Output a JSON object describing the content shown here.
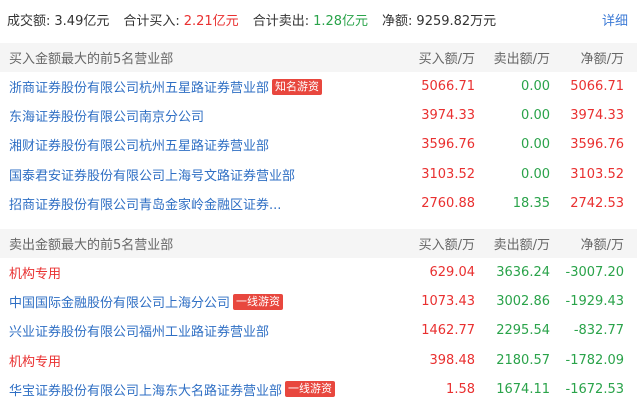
{
  "summary": {
    "turnover_label": "成交额:",
    "turnover_value": "3.49亿元",
    "total_buy_label": "合计买入:",
    "total_buy_value": "2.21亿元",
    "total_sell_label": "合计卖出:",
    "total_sell_value": "1.28亿元",
    "net_label": "净额:",
    "net_value": "9259.82万元",
    "detail_link": "详细"
  },
  "buy_section": {
    "title": "买入金额最大的前5名营业部",
    "col_buy": "买入额/万",
    "col_sell": "卖出额/万",
    "col_net": "净额/万",
    "rows": [
      {
        "name": "浙商证券股份有限公司杭州五星路证券营业部",
        "tag": "知名游资",
        "buy": "5066.71",
        "sell": "0.00",
        "net": "5066.71"
      },
      {
        "name": "东海证券股份有限公司南京分公司",
        "tag": "",
        "buy": "3974.33",
        "sell": "0.00",
        "net": "3974.33"
      },
      {
        "name": "湘财证券股份有限公司杭州五星路证券营业部",
        "tag": "",
        "buy": "3596.76",
        "sell": "0.00",
        "net": "3596.76"
      },
      {
        "name": "国泰君安证券股份有限公司上海号文路证券营业部",
        "tag": "",
        "buy": "3103.52",
        "sell": "0.00",
        "net": "3103.52"
      },
      {
        "name": "招商证券股份有限公司青岛金家岭金融区证券...",
        "tag": "",
        "buy": "2760.88",
        "sell": "18.35",
        "net": "2742.53"
      }
    ]
  },
  "sell_section": {
    "title": "卖出金额最大的前5名营业部",
    "col_buy": "买入额/万",
    "col_sell": "卖出额/万",
    "col_net": "净额/万",
    "rows": [
      {
        "name": "机构专用",
        "tag": "",
        "buy": "629.04",
        "sell": "3636.24",
        "net": "-3007.20"
      },
      {
        "name": "中国国际金融股份有限公司上海分公司",
        "tag": "一线游资",
        "buy": "1073.43",
        "sell": "3002.86",
        "net": "-1929.43"
      },
      {
        "name": "兴业证券股份有限公司福州工业路证券营业部",
        "tag": "",
        "buy": "1462.77",
        "sell": "2295.54",
        "net": "-832.77"
      },
      {
        "name": "机构专用",
        "tag": "",
        "buy": "398.48",
        "sell": "2180.57",
        "net": "-1782.09"
      },
      {
        "name": "华宝证券股份有限公司上海东大名路证券营业部",
        "tag": "一线游资",
        "buy": "1.58",
        "sell": "1674.11",
        "net": "-1672.53"
      }
    ]
  }
}
